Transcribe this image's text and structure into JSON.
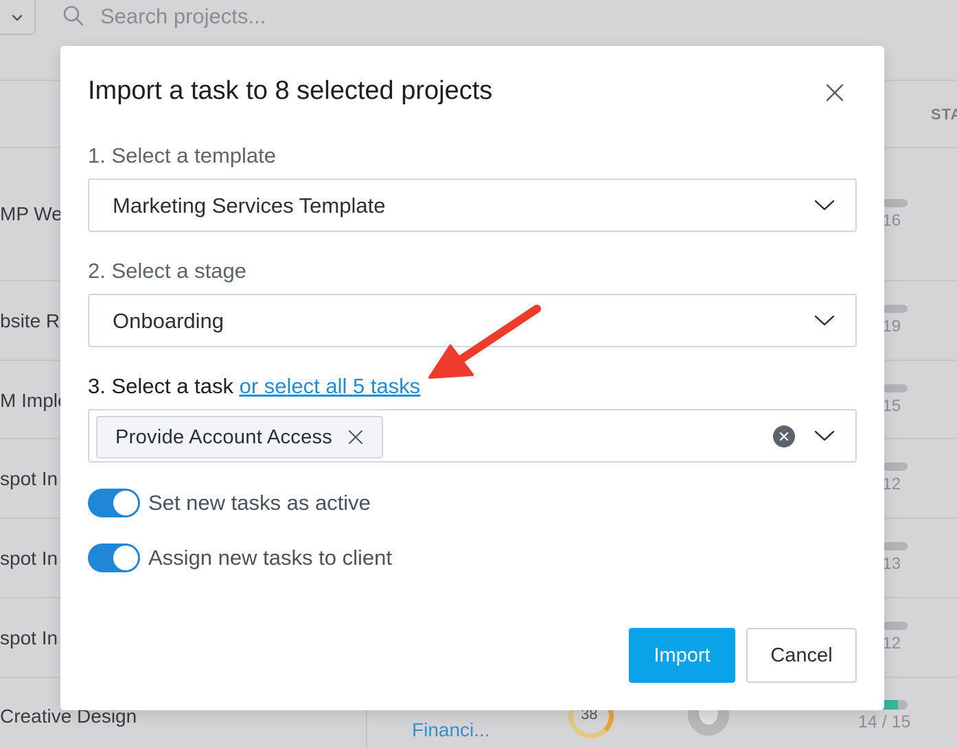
{
  "background": {
    "search": {
      "placeholder": "Search projects..."
    },
    "column_header": "STA",
    "rows": [
      {
        "name": "MP We",
        "count": "16"
      },
      {
        "name": "bsite R",
        "count": "19"
      },
      {
        "name": "M Imple",
        "count": "15"
      },
      {
        "name": "spot In",
        "count": "12"
      },
      {
        "name": "spot In",
        "count": "13"
      },
      {
        "name": "spot In",
        "count": "12"
      }
    ],
    "last_row": {
      "name": "Creative Design",
      "category": "Financi...",
      "score": "38",
      "progress": "14 / 15",
      "progress_fraction": 0.93
    }
  },
  "modal": {
    "title": "Import a task to 8 selected projects",
    "step1": {
      "label": "1. Select a template",
      "value": "Marketing Services Template"
    },
    "step2": {
      "label": "2. Select a stage",
      "value": "Onboarding"
    },
    "step3": {
      "label": "3. Select a task",
      "link": "or select all 5 tasks",
      "selected": [
        "Provide Account Access"
      ]
    },
    "toggles": [
      {
        "label": "Set new tasks as active",
        "on": true
      },
      {
        "label": "Assign new tasks to client",
        "on": true
      }
    ],
    "buttons": {
      "import": "Import",
      "cancel": "Cancel"
    }
  },
  "colors": {
    "primary": "#0aa2e8",
    "toggle_on": "#1e88d6",
    "link": "#1f8ed6",
    "annotation_arrow": "#ee3b2b"
  }
}
